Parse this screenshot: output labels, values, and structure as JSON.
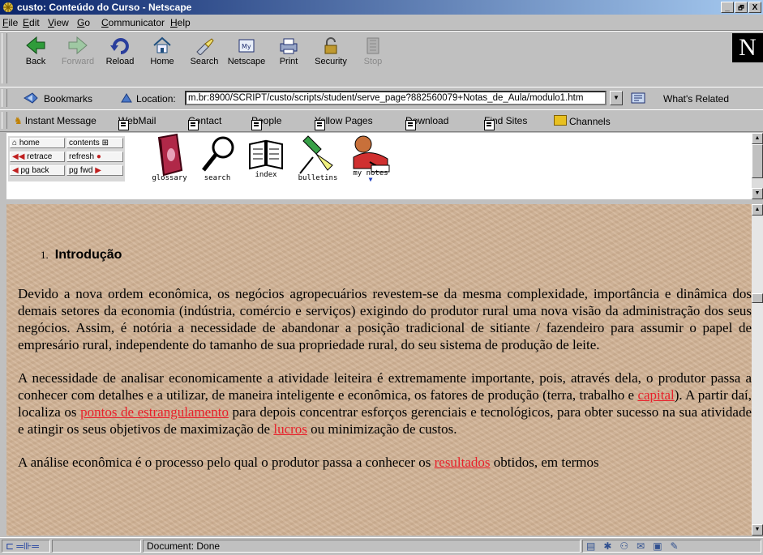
{
  "window": {
    "title": "custo: Conteúdo do Curso - Netscape",
    "buttons": [
      "_",
      "🗗",
      "X"
    ]
  },
  "menu": [
    {
      "key": "F",
      "rest": "ile"
    },
    {
      "key": "E",
      "rest": "dit"
    },
    {
      "key": "V",
      "rest": "iew"
    },
    {
      "key": "G",
      "rest": "o"
    },
    {
      "key": "C",
      "rest": "ommunicator"
    },
    {
      "key": "H",
      "rest": "elp"
    }
  ],
  "toolbar": {
    "back": "Back",
    "forward": "Forward",
    "reload": "Reload",
    "home": "Home",
    "search": "Search",
    "netscape": "Netscape",
    "print": "Print",
    "security": "Security",
    "stop": "Stop",
    "logo": "N"
  },
  "location_bar": {
    "bookmarks": "Bookmarks",
    "location_label": "Location:",
    "url": "m.br:8900/SCRIPT/custo/scripts/student/serve_page?882560079+Notas_de_Aula/modulo1.htm",
    "whats_related": "What's Related"
  },
  "personal_toolbar": {
    "instant_message": "Instant Message",
    "webmail": "WebMail",
    "contact": "Contact",
    "people": "People",
    "yellow_pages": "Yellow Pages",
    "download": "Download",
    "find_sites": "Find Sites",
    "channels": "Channels"
  },
  "course_nav": {
    "home": "home",
    "contents": "contents",
    "retrace": "retrace",
    "refresh": "refresh",
    "pg_back": "pg back",
    "pg_fwd": "pg fwd",
    "glossary": "glossary",
    "search": "search",
    "index": "index",
    "bulletins": "bulletins",
    "my_notes": "my notes"
  },
  "content": {
    "heading_number": "1.",
    "heading": "Introdução",
    "p1": "Devido a nova ordem econômica, os negócios agropecuários revestem-se da mesma complexidade, importância e dinâmica dos demais setores da economia (indústria, comércio e serviços) exigindo do produtor rural uma nova visão da administração dos seus negócios. Assim, é notória a necessidade de abandonar a posição tradicional de sitiante / fazendeiro para assumir o papel de empresário rural, independente do tamanho de sua propriedade rural, do seu sistema de produção de leite.",
    "p2": {
      "t1": "A necessidade de analisar economicamente a atividade leiteira é extremamente importante, pois, através dela, o produtor passa a conhecer com detalhes e a utilizar, de maneira inteligente e econômica, os fatores de produção (terra, trabalho e ",
      "link1": "capital",
      "t2": "). A partir daí, localiza os ",
      "link2": "pontos de estrangulamento",
      "t3": " para depois concentrar esforços gerenciais e tecnológicos, para obter sucesso na sua atividade e atingir os seus objetivos de maximização de ",
      "link3": "lucros",
      "t4": " ou minimização de custos."
    },
    "p3": {
      "t1": "A análise econômica é o processo pelo qual o produtor passa a conhecer os ",
      "link1": "resultados",
      "t2": " obtidos, em termos"
    }
  },
  "status": {
    "text": "Document: Done"
  }
}
